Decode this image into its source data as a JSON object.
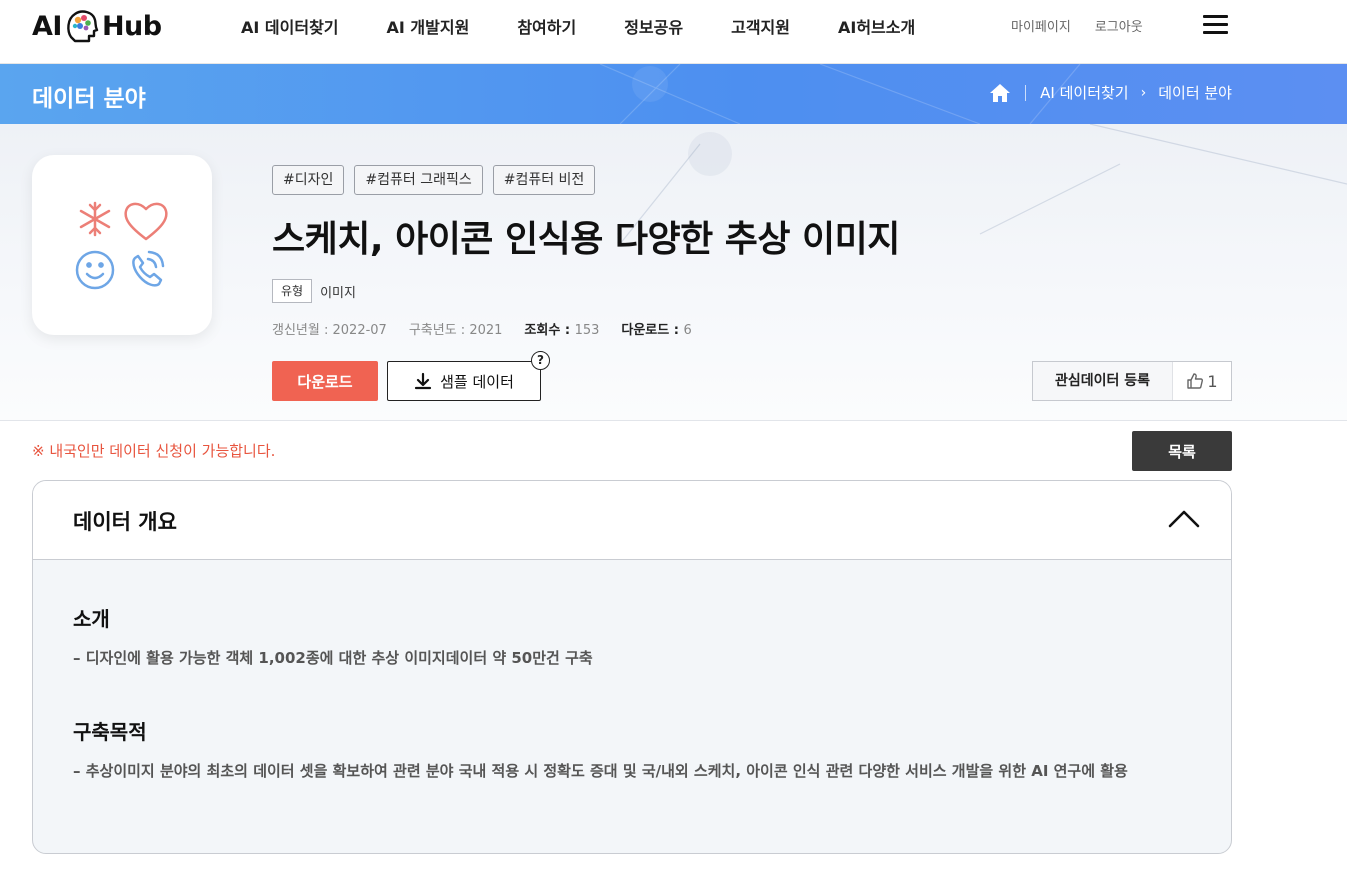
{
  "header": {
    "logo_left": "AI",
    "logo_right": "Hub",
    "nav": [
      "AI 데이터찾기",
      "AI 개발지원",
      "참여하기",
      "정보공유",
      "고객지원",
      "AI허브소개"
    ],
    "mypage": "마이페이지",
    "logout": "로그아웃"
  },
  "banner": {
    "title": "데이터 분야",
    "breadcrumb": [
      "AI 데이터찾기",
      "데이터 분야"
    ]
  },
  "dataset": {
    "tags": [
      "#디자인",
      "#컴퓨터 그래픽스",
      "#컴퓨터 비전"
    ],
    "title": "스케치, 아이콘 인식용 다양한 추상 이미지",
    "type_label": "유형",
    "type_value": "이미지",
    "meta": [
      {
        "label": "갱신년월 : ",
        "value": "2022-07",
        "bold": false
      },
      {
        "label": "구축년도 : ",
        "value": "2021",
        "bold": false
      },
      {
        "label": "조회수 : ",
        "value": "153",
        "bold": true
      },
      {
        "label": "다운로드 : ",
        "value": "6",
        "bold": true
      }
    ],
    "download_label": "다운로드",
    "sample_label": "샘플 데이터",
    "help_mark": "?",
    "interest_label": "관심데이터 등록",
    "like_count": "1"
  },
  "notice": "※ 내국인만 데이터 신청이 가능합니다.",
  "list_button": "목록",
  "overview": {
    "title": "데이터 개요",
    "sections": [
      {
        "heading": "소개",
        "body": "– 디자인에 활용 가능한 객체 1,002종에 대한 추상 이미지데이터 약 50만건 구축"
      },
      {
        "heading": "구축목적",
        "body": "– 추상이미지 분야의 최초의 데이터 셋을 확보하여 관련 분야 국내 적용 시 정확도 증대 및 국/내외 스케치, 아이콘 인식 관련 다양한 서비스 개발을 위한 AI 연구에 활용"
      }
    ]
  },
  "colors": {
    "accent_red": "#f06352",
    "banner_blue": "#4d8ff0",
    "notice_red": "#e8553f",
    "dark_button": "#3a3a3a"
  }
}
